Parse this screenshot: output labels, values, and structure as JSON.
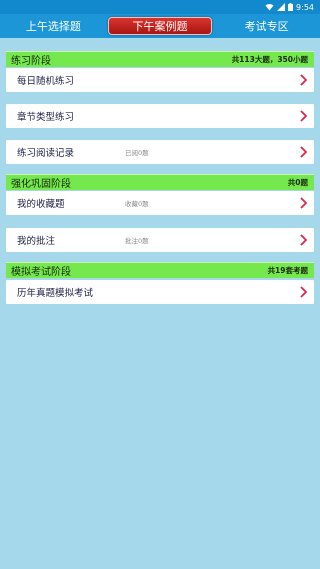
{
  "status_bar": {
    "time": "9:54"
  },
  "tabs": [
    {
      "label": "上午选择题",
      "active": false
    },
    {
      "label": "下午案例题",
      "active": true
    },
    {
      "label": "考试专区",
      "active": false
    }
  ],
  "sections": [
    {
      "title": "练习阶段",
      "count": "共113大题，350小题",
      "items": [
        {
          "label": "每日随机练习",
          "meta": ""
        },
        {
          "label": "章节类型练习",
          "meta": ""
        },
        {
          "label": "练习阅读记录",
          "meta": "已阅0题"
        }
      ]
    },
    {
      "title": "强化巩固阶段",
      "count": "共0题",
      "items": [
        {
          "label": "我的收藏题",
          "meta": "收藏0题"
        },
        {
          "label": "我的批注",
          "meta": "批注0题"
        }
      ]
    },
    {
      "title": "模拟考试阶段",
      "count": "共19套考题",
      "items": [
        {
          "label": "历年真题模拟考试",
          "meta": ""
        }
      ]
    }
  ],
  "colors": {
    "status_bar": "#1189cc",
    "tab_bar": "#1c96d6",
    "active_tab": "#c12520",
    "section_header": "#74e84c",
    "background": "#a4d8ea",
    "chevron": "#e0264b"
  }
}
